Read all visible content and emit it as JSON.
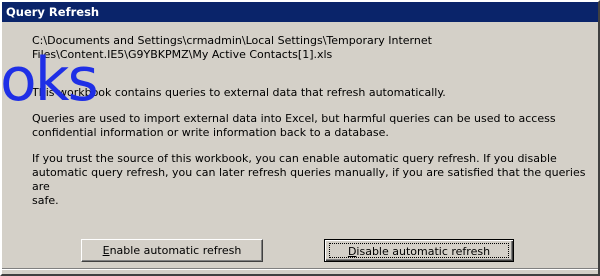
{
  "dialog": {
    "title": "Query Refresh",
    "path_line1": "C:\\Documents and Settings\\crmadmin\\Local Settings\\Temporary Internet",
    "path_line2": "Files\\Content.IE5\\G9YBKPMZ\\My Active Contacts[1].xls",
    "para1": "This workbook contains queries to external data that refresh automatically.",
    "para2_line1": "Queries are used to import external data into Excel, but harmful queries can be used to access",
    "para2_line2": "confidential information or write information back to a database.",
    "para3_line1": "If you trust the source of this workbook, you can enable automatic query refresh. If you disable",
    "para3_line2": "automatic query refresh, you can later refresh queries manually, if you are satisfied that the queries are",
    "para3_line3": "safe."
  },
  "watermark": {
    "text": "oks",
    "color": "#1f2fe6"
  },
  "buttons": {
    "enable": {
      "first_letter": "E",
      "rest": "nable automatic refresh"
    },
    "disable": {
      "first_letter": "D",
      "rest": "isable automatic refresh"
    }
  },
  "colors": {
    "titlebar": "#0a246a",
    "dialog_bg": "#d4d0c8"
  }
}
